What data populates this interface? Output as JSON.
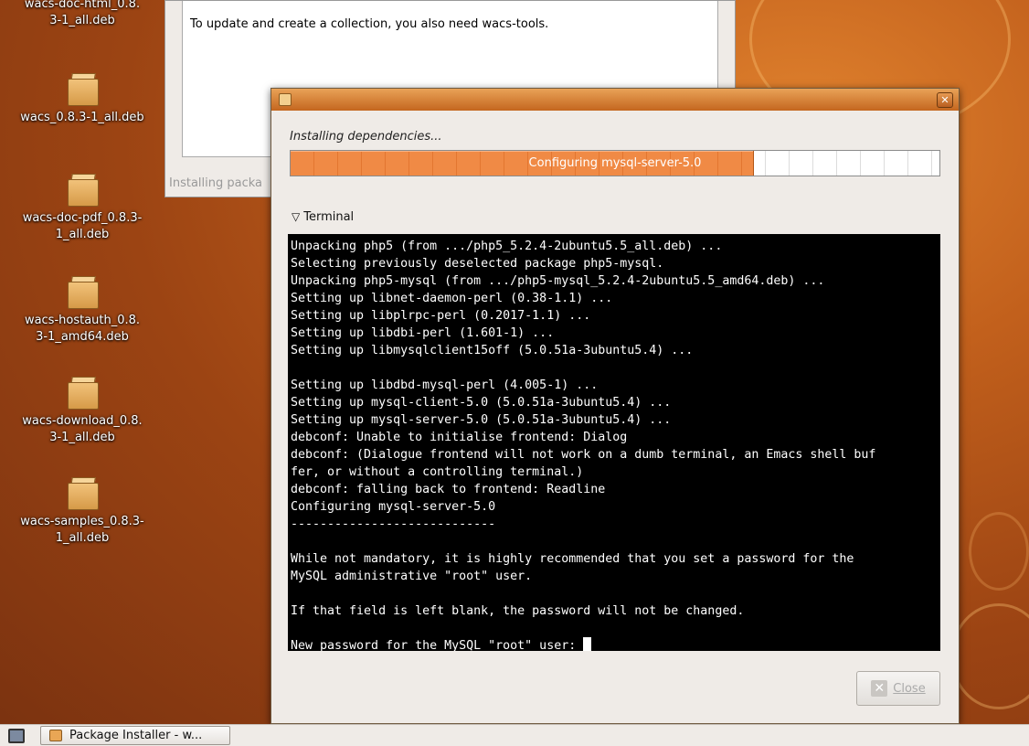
{
  "desktop": {
    "icons": [
      {
        "label": "wacs-doc-html_0.8.\n3-1_all.deb"
      },
      {
        "label": "wacs_0.8.3-1_all.deb"
      },
      {
        "label": "wacs-doc-pdf_0.8.3-\n1_all.deb"
      },
      {
        "label": "wacs-hostauth_0.8.\n3-1_amd64.deb"
      },
      {
        "label": "wacs-download_0.8.\n3-1_all.deb"
      },
      {
        "label": "wacs-samples_0.8.3-\n1_all.deb"
      }
    ]
  },
  "background_window": {
    "message": "To update and create a collection, you also need wacs-tools.",
    "status": "Installing packa"
  },
  "dialog": {
    "heading": "Installing dependencies...",
    "progress": {
      "fraction": 0.713,
      "text": "Configuring mysql-server-5.0"
    },
    "terminal_toggle": "Terminal",
    "terminal_lines": [
      "Unpacking php5 (from .../php5_5.2.4-2ubuntu5.5_all.deb) ...",
      "Selecting previously deselected package php5-mysql.",
      "Unpacking php5-mysql (from .../php5-mysql_5.2.4-2ubuntu5.5_amd64.deb) ...",
      "Setting up libnet-daemon-perl (0.38-1.1) ...",
      "Setting up libplrpc-perl (0.2017-1.1) ...",
      "Setting up libdbi-perl (1.601-1) ...",
      "Setting up libmysqlclient15off (5.0.51a-3ubuntu5.4) ...",
      "",
      "Setting up libdbd-mysql-perl (4.005-1) ...",
      "Setting up mysql-client-5.0 (5.0.51a-3ubuntu5.4) ...",
      "Setting up mysql-server-5.0 (5.0.51a-3ubuntu5.4) ...",
      "debconf: Unable to initialise frontend: Dialog",
      "debconf: (Dialogue frontend will not work on a dumb terminal, an Emacs shell buf",
      "fer, or without a controlling terminal.)",
      "debconf: falling back to frontend: Readline",
      "Configuring mysql-server-5.0",
      "----------------------------",
      "",
      "While not mandatory, it is highly recommended that you set a password for the",
      "MySQL administrative \"root\" user.",
      "",
      "If that field is left blank, the password will not be changed.",
      ""
    ],
    "prompt": "New password for the MySQL \"root\" user: ",
    "close_label": "Close"
  },
  "taskbar": {
    "task_label": "Package Installer - w..."
  }
}
